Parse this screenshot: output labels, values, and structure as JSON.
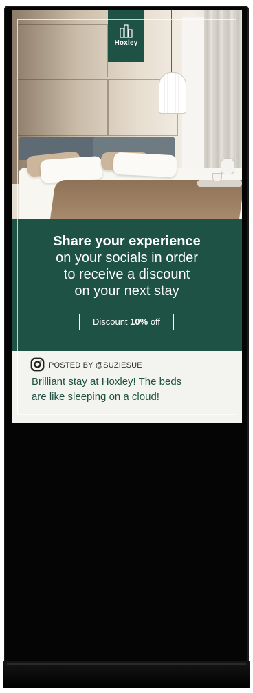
{
  "brand": {
    "name": "Hoxley",
    "color": "#1e5244"
  },
  "promo": {
    "headline": "Share your experience",
    "lines": [
      "on your socials in order",
      "to receive a discount",
      "on your next stay"
    ],
    "discount_prefix": "Discount",
    "discount_value": "10%",
    "discount_suffix": "off"
  },
  "post": {
    "icon": "instagram-icon",
    "posted_by": "POSTED BY @SUZIESUE",
    "text_line1": "Brilliant stay at Hoxley! The beds",
    "text_line2": "are like sleeping on a cloud!"
  }
}
